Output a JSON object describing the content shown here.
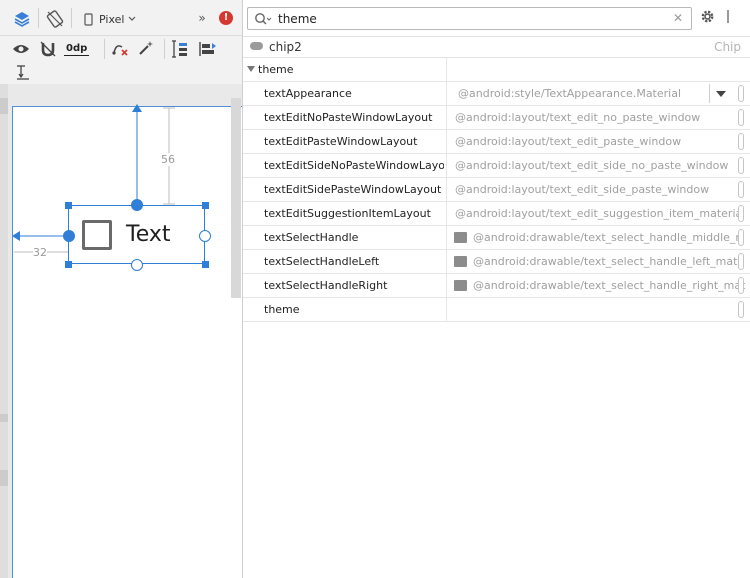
{
  "toolbar": {
    "device_label": "Pixel",
    "overflow_glyph": "»",
    "error_glyph": "!",
    "margin_value": "0dp"
  },
  "canvas": {
    "widget_text": "Text",
    "dim_top": "56",
    "dim_left": "32"
  },
  "attributes": {
    "search_value": "theme",
    "search_clear": "✕",
    "component_name": "chip2",
    "component_type": "Chip",
    "section_label": "theme",
    "properties": [
      {
        "name": "textAppearance",
        "value": "@android:style/TextAppearance.Material"
      },
      {
        "name": "textEditNoPasteWindowLayout",
        "value": "@android:layout/text_edit_no_paste_window"
      },
      {
        "name": "textEditPasteWindowLayout",
        "value": "@android:layout/text_edit_paste_window"
      },
      {
        "name": "textEditSideNoPasteWindowLayo...",
        "value": "@android:layout/text_edit_side_no_paste_window"
      },
      {
        "name": "textEditSidePasteWindowLayout",
        "value": "@android:layout/text_edit_side_paste_window"
      },
      {
        "name": "textEditSuggestionItemLayout",
        "value": "@android:layout/text_edit_suggestion_item_materia"
      },
      {
        "name": "textSelectHandle",
        "value": "@android:drawable/text_select_handle_middle_n"
      },
      {
        "name": "textSelectHandleLeft",
        "value": "@android:drawable/text_select_handle_left_mate"
      },
      {
        "name": "textSelectHandleRight",
        "value": "@android:drawable/text_select_handle_right_mat"
      },
      {
        "name": "theme",
        "value": ""
      }
    ]
  },
  "colors": {
    "accent_blue": "#2f7fd8",
    "error_red": "#d6372f"
  }
}
